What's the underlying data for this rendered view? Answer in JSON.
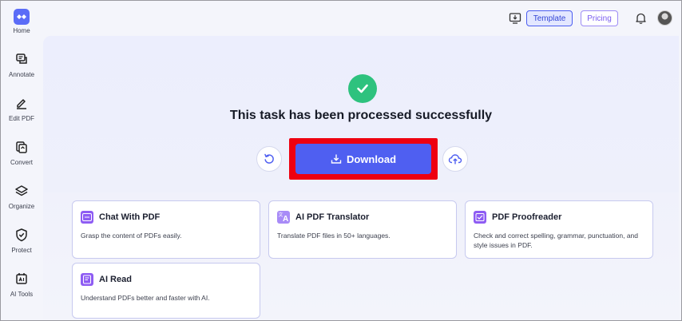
{
  "sidebar": {
    "items": [
      {
        "label": "Home",
        "icon": "home-logo-icon"
      },
      {
        "label": "Annotate",
        "icon": "annotate-icon"
      },
      {
        "label": "Edit PDF",
        "icon": "edit-pdf-icon"
      },
      {
        "label": "Convert",
        "icon": "convert-icon"
      },
      {
        "label": "Organize",
        "icon": "organize-icon"
      },
      {
        "label": "Protect",
        "icon": "protect-icon"
      },
      {
        "label": "AI Tools",
        "icon": "ai-tools-icon"
      }
    ]
  },
  "topbar": {
    "template_label": "Template",
    "pricing_label": "Pricing"
  },
  "main": {
    "status_title": "This task has been processed successfully",
    "download_label": "Download"
  },
  "cards": [
    {
      "title": "Chat With PDF",
      "description": "Grasp the content of PDFs easily.",
      "icon": "chat-icon"
    },
    {
      "title": "AI PDF Translator",
      "description": "Translate PDF files in 50+ languages.",
      "icon": "translate-icon"
    },
    {
      "title": "PDF Proofreader",
      "description": "Check and correct spelling, grammar, punctuation, and style issues in PDF.",
      "icon": "proofread-icon"
    },
    {
      "title": "AI Read",
      "description": "Understand PDFs better and faster with AI.",
      "icon": "ai-read-icon"
    }
  ],
  "colors": {
    "accent": "#4f5ff1",
    "success": "#2ec27e",
    "highlight": "#ee0010",
    "card_icon": "#8e5cf3"
  }
}
